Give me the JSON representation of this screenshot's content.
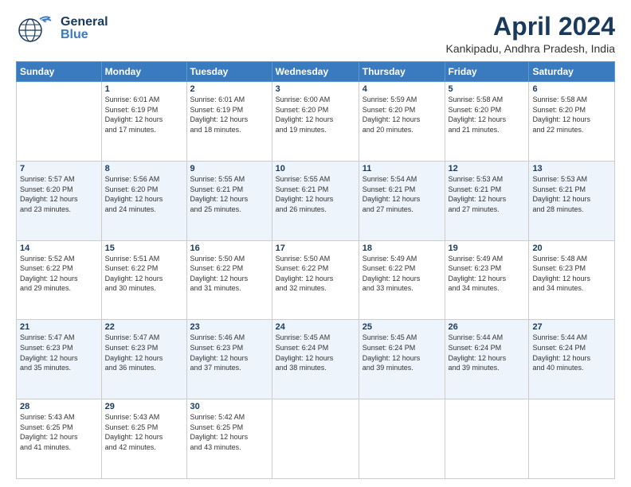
{
  "header": {
    "logo_general": "General",
    "logo_blue": "Blue",
    "title": "April 2024",
    "subtitle": "Kankipadu, Andhra Pradesh, India"
  },
  "weekdays": [
    "Sunday",
    "Monday",
    "Tuesday",
    "Wednesday",
    "Thursday",
    "Friday",
    "Saturday"
  ],
  "weeks": [
    [
      {
        "day": "",
        "info": ""
      },
      {
        "day": "1",
        "info": "Sunrise: 6:01 AM\nSunset: 6:19 PM\nDaylight: 12 hours\nand 17 minutes."
      },
      {
        "day": "2",
        "info": "Sunrise: 6:01 AM\nSunset: 6:19 PM\nDaylight: 12 hours\nand 18 minutes."
      },
      {
        "day": "3",
        "info": "Sunrise: 6:00 AM\nSunset: 6:20 PM\nDaylight: 12 hours\nand 19 minutes."
      },
      {
        "day": "4",
        "info": "Sunrise: 5:59 AM\nSunset: 6:20 PM\nDaylight: 12 hours\nand 20 minutes."
      },
      {
        "day": "5",
        "info": "Sunrise: 5:58 AM\nSunset: 6:20 PM\nDaylight: 12 hours\nand 21 minutes."
      },
      {
        "day": "6",
        "info": "Sunrise: 5:58 AM\nSunset: 6:20 PM\nDaylight: 12 hours\nand 22 minutes."
      }
    ],
    [
      {
        "day": "7",
        "info": "Sunrise: 5:57 AM\nSunset: 6:20 PM\nDaylight: 12 hours\nand 23 minutes."
      },
      {
        "day": "8",
        "info": "Sunrise: 5:56 AM\nSunset: 6:20 PM\nDaylight: 12 hours\nand 24 minutes."
      },
      {
        "day": "9",
        "info": "Sunrise: 5:55 AM\nSunset: 6:21 PM\nDaylight: 12 hours\nand 25 minutes."
      },
      {
        "day": "10",
        "info": "Sunrise: 5:55 AM\nSunset: 6:21 PM\nDaylight: 12 hours\nand 26 minutes."
      },
      {
        "day": "11",
        "info": "Sunrise: 5:54 AM\nSunset: 6:21 PM\nDaylight: 12 hours\nand 27 minutes."
      },
      {
        "day": "12",
        "info": "Sunrise: 5:53 AM\nSunset: 6:21 PM\nDaylight: 12 hours\nand 27 minutes."
      },
      {
        "day": "13",
        "info": "Sunrise: 5:53 AM\nSunset: 6:21 PM\nDaylight: 12 hours\nand 28 minutes."
      }
    ],
    [
      {
        "day": "14",
        "info": "Sunrise: 5:52 AM\nSunset: 6:22 PM\nDaylight: 12 hours\nand 29 minutes."
      },
      {
        "day": "15",
        "info": "Sunrise: 5:51 AM\nSunset: 6:22 PM\nDaylight: 12 hours\nand 30 minutes."
      },
      {
        "day": "16",
        "info": "Sunrise: 5:50 AM\nSunset: 6:22 PM\nDaylight: 12 hours\nand 31 minutes."
      },
      {
        "day": "17",
        "info": "Sunrise: 5:50 AM\nSunset: 6:22 PM\nDaylight: 12 hours\nand 32 minutes."
      },
      {
        "day": "18",
        "info": "Sunrise: 5:49 AM\nSunset: 6:22 PM\nDaylight: 12 hours\nand 33 minutes."
      },
      {
        "day": "19",
        "info": "Sunrise: 5:49 AM\nSunset: 6:23 PM\nDaylight: 12 hours\nand 34 minutes."
      },
      {
        "day": "20",
        "info": "Sunrise: 5:48 AM\nSunset: 6:23 PM\nDaylight: 12 hours\nand 34 minutes."
      }
    ],
    [
      {
        "day": "21",
        "info": "Sunrise: 5:47 AM\nSunset: 6:23 PM\nDaylight: 12 hours\nand 35 minutes."
      },
      {
        "day": "22",
        "info": "Sunrise: 5:47 AM\nSunset: 6:23 PM\nDaylight: 12 hours\nand 36 minutes."
      },
      {
        "day": "23",
        "info": "Sunrise: 5:46 AM\nSunset: 6:23 PM\nDaylight: 12 hours\nand 37 minutes."
      },
      {
        "day": "24",
        "info": "Sunrise: 5:45 AM\nSunset: 6:24 PM\nDaylight: 12 hours\nand 38 minutes."
      },
      {
        "day": "25",
        "info": "Sunrise: 5:45 AM\nSunset: 6:24 PM\nDaylight: 12 hours\nand 39 minutes."
      },
      {
        "day": "26",
        "info": "Sunrise: 5:44 AM\nSunset: 6:24 PM\nDaylight: 12 hours\nand 39 minutes."
      },
      {
        "day": "27",
        "info": "Sunrise: 5:44 AM\nSunset: 6:24 PM\nDaylight: 12 hours\nand 40 minutes."
      }
    ],
    [
      {
        "day": "28",
        "info": "Sunrise: 5:43 AM\nSunset: 6:25 PM\nDaylight: 12 hours\nand 41 minutes."
      },
      {
        "day": "29",
        "info": "Sunrise: 5:43 AM\nSunset: 6:25 PM\nDaylight: 12 hours\nand 42 minutes."
      },
      {
        "day": "30",
        "info": "Sunrise: 5:42 AM\nSunset: 6:25 PM\nDaylight: 12 hours\nand 43 minutes."
      },
      {
        "day": "",
        "info": ""
      },
      {
        "day": "",
        "info": ""
      },
      {
        "day": "",
        "info": ""
      },
      {
        "day": "",
        "info": ""
      }
    ]
  ]
}
